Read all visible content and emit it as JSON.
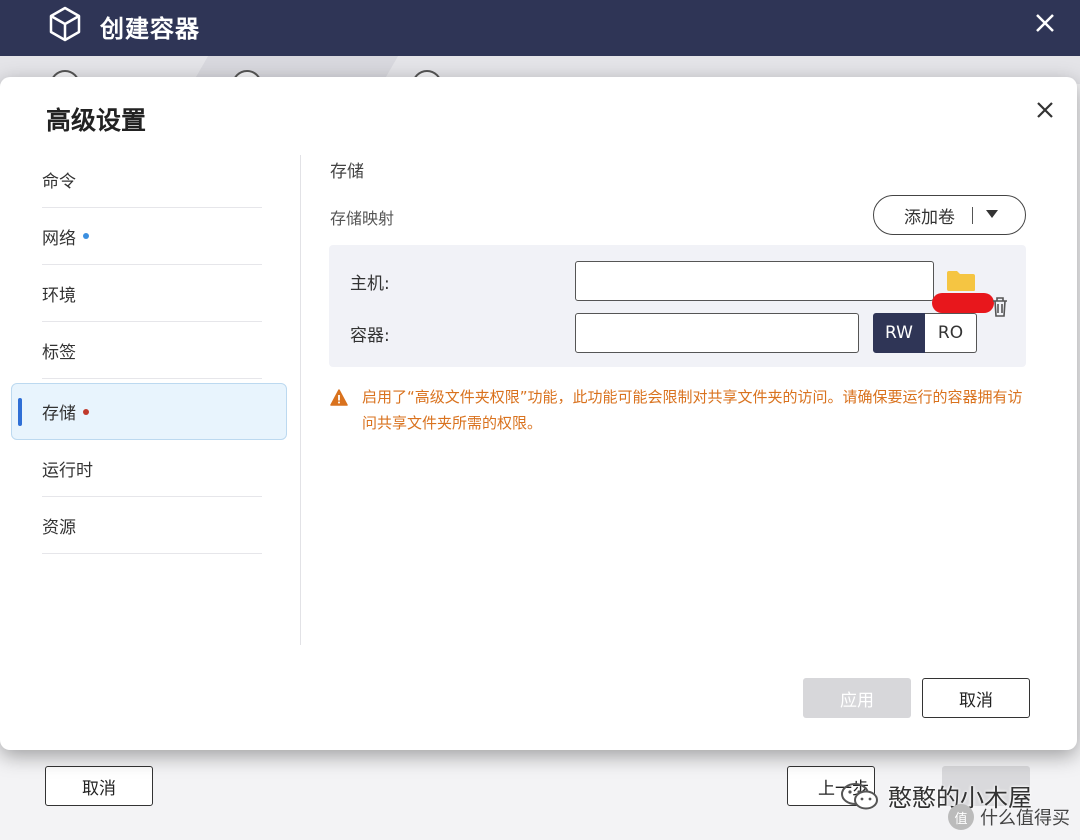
{
  "background_window": {
    "title": "创建容器",
    "cancel_label": "取消",
    "prev_label": "上一步"
  },
  "modal": {
    "title": "高级设置",
    "nav": [
      {
        "label": "命令"
      },
      {
        "label": "网络"
      },
      {
        "label": "环境"
      },
      {
        "label": "标签"
      },
      {
        "label": "存储"
      },
      {
        "label": "运行时"
      },
      {
        "label": "资源"
      }
    ],
    "active_item": "存储",
    "storage": {
      "section_title": "存储",
      "mapping_label": "存储映射",
      "add_volume_label": "添加卷",
      "host_label": "主机:",
      "host_value": "",
      "container_label": "容器:",
      "container_value": "",
      "rw_label": "RW",
      "ro_label": "RO",
      "selected_mode": "RW",
      "warning": "启用了“高级文件夹权限”功能，此功能可能会限制对共享文件夹的访问。请确保要运行的容器拥有访问共享文件夹所需的权限。"
    },
    "apply_label": "应用",
    "cancel_label": "取消"
  },
  "watermark": {
    "text": "憨憨的小木屋",
    "sub": "什么值得买",
    "sub_icon": "值"
  },
  "colors": {
    "header": "#2f3556",
    "active_nav_bg": "#e8f4fd",
    "active_indicator": "#2f6fd6",
    "network_dot": "#3b8fe0",
    "storage_dot": "#c0392b",
    "warning": "#d9721e",
    "folder": "#f5c542"
  }
}
